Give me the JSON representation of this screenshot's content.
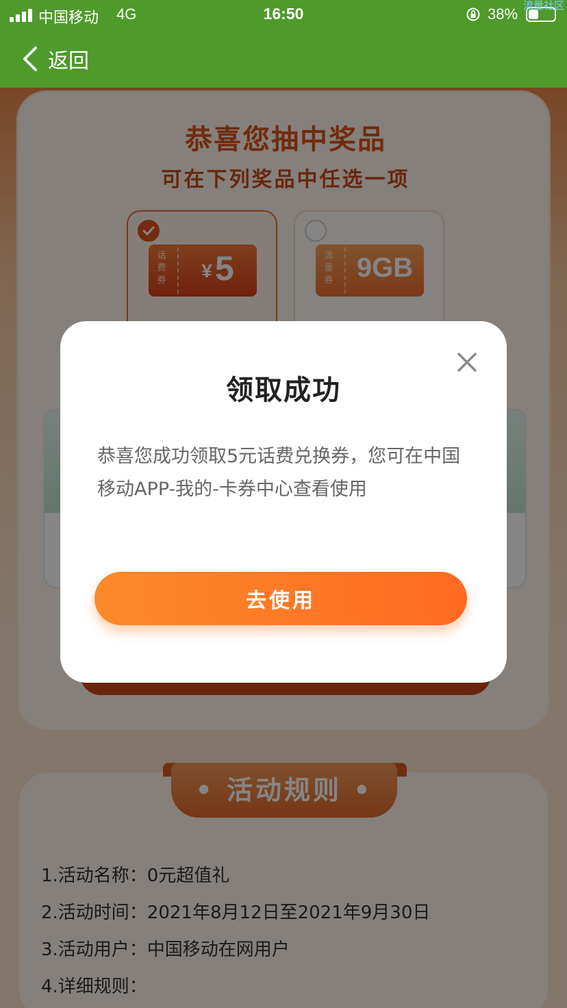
{
  "status_bar": {
    "carrier": "中国移动",
    "network": "4G",
    "time": "16:50",
    "battery_percent": "38%",
    "battery_level": 0.38,
    "watermark": "流量社区"
  },
  "nav": {
    "back_label": "返回",
    "bar_color": "#4e9a2b"
  },
  "prize_section": {
    "title": "恭喜您抽中奖品",
    "subtitle": "可在下列奖品中任选一项",
    "options": [
      {
        "side_label": "话费券",
        "value": "5",
        "currency": "¥",
        "selected": true
      },
      {
        "side_label": "流量券",
        "value": "9GB",
        "selected": false
      }
    ]
  },
  "rules": {
    "heading": "活动规则",
    "lines": [
      "1.活动名称：0元超值礼",
      "2.活动时间：2021年8月12日至2021年9月30日",
      "3.活动用户：中国移动在网用户",
      "4.详细规则："
    ]
  },
  "modal": {
    "title": "领取成功",
    "message": "恭喜您成功领取5元话费兑换券，您可在中国移动APP-我的-卡券中心查看使用",
    "button_label": "去使用",
    "close_icon": "close-icon",
    "accent_color": "#ff7a28"
  }
}
